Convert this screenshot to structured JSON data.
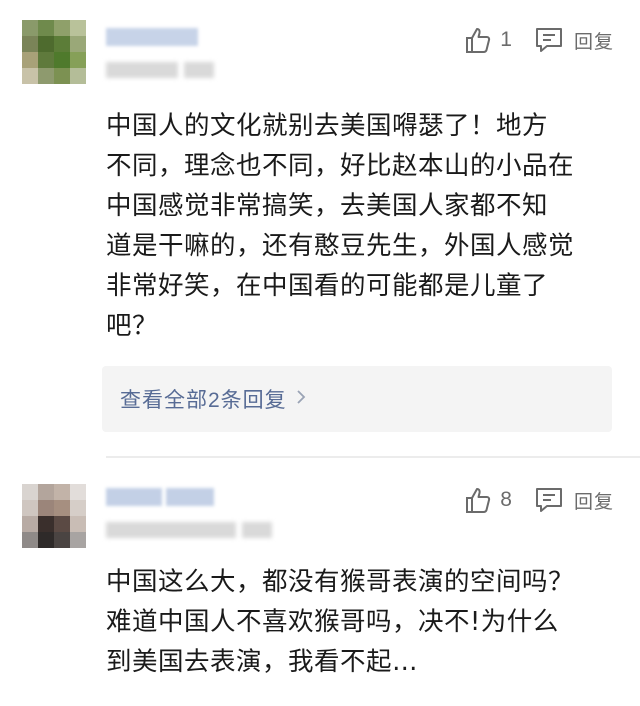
{
  "comments": [
    {
      "likes": "1",
      "reply_label": "回复",
      "text_lines": [
        "中国人的文化就别去美国嘚瑟了！地方",
        "不同，理念也不同，好比赵本山的小品在",
        "中国感觉非常搞笑，去美国人家都不知",
        "道是干嘛的，还有憨豆先生，外国人感觉",
        "非常好笑，在中国看的可能都是儿童了",
        "吧？"
      ],
      "more_replies": "查看全部2条回复"
    },
    {
      "likes": "8",
      "reply_label": "回复",
      "text_lines": [
        "中国这么大，都没有猴哥表演的空间吗？",
        "难道中国人不喜欢猴哥吗，决不!为什么",
        "到美国去表演，我看不起…"
      ]
    }
  ],
  "icons": {
    "like": "thumbs-up-icon",
    "reply": "comment-icon",
    "chevron": "chevron-right-icon"
  },
  "colors": {
    "link": "#576b95",
    "meta": "#6b6b6b",
    "reply_box_bg": "#f4f4f4"
  }
}
